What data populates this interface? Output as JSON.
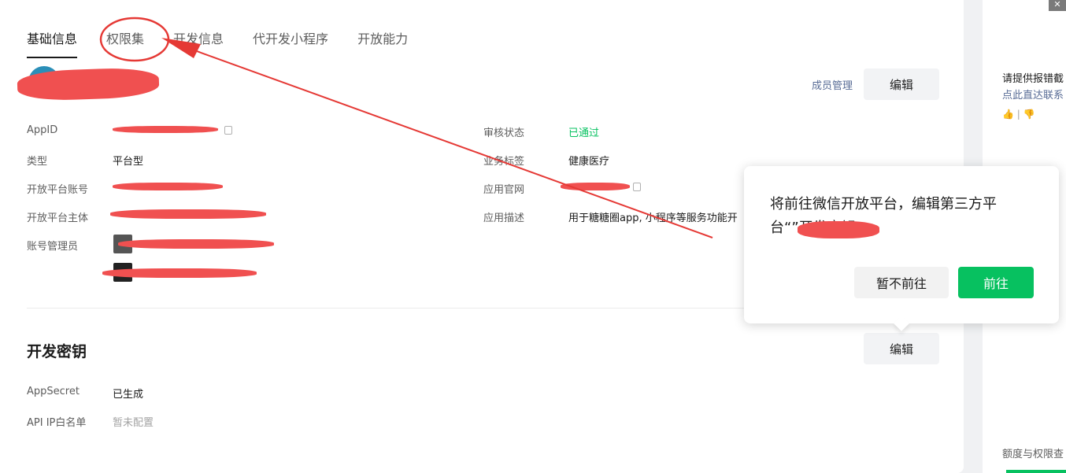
{
  "tabs": [
    "基础信息",
    "权限集",
    "开发信息",
    "代开发小程序",
    "开放能力"
  ],
  "header": {
    "app_name": "",
    "member_link": "成员管理",
    "edit": "编辑"
  },
  "info_left": [
    {
      "label": "AppID",
      "value": ""
    },
    {
      "label": "类型",
      "value": "平台型"
    },
    {
      "label": "开放平台账号",
      "value": ""
    },
    {
      "label": "开放平台主体",
      "value": ""
    },
    {
      "label": "账号管理员",
      "value": ""
    }
  ],
  "info_right": [
    {
      "label": "审核状态",
      "value": "已通过"
    },
    {
      "label": "业务标签",
      "value": "健康医疗"
    },
    {
      "label": "应用官网",
      "value": ""
    },
    {
      "label": "应用描述",
      "value": "用于糖糖圈app, 小程序等服务功能开"
    }
  ],
  "dev_key": {
    "title": "开发密钥",
    "edit": "编辑",
    "rows": [
      {
        "label": "AppSecret",
        "value": "已生成"
      },
      {
        "label": "API IP白名单",
        "value": "暂未配置"
      }
    ]
  },
  "popover": {
    "text": "将前往微信开放平台，编辑第三方平台“”开发密钥",
    "cancel": "暂不前往",
    "confirm": "前往"
  },
  "right_panel": {
    "title": "请提供报错截",
    "link": "点此直达联系",
    "feedback": "👍 | 👎",
    "footer": "额度与权限查",
    "close": "✕"
  },
  "colors": {
    "accent_green": "#07c160",
    "link_blue": "#576b95",
    "annotation_red": "#e53935"
  }
}
